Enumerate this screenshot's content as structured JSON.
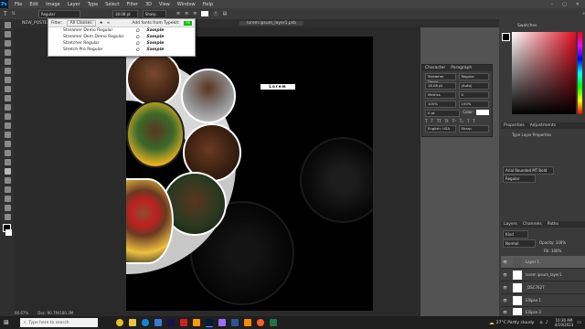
{
  "app": {
    "name": "Ps"
  },
  "menu": [
    "File",
    "Edit",
    "Image",
    "Layer",
    "Type",
    "Select",
    "Filter",
    "3D",
    "View",
    "Window",
    "Help"
  ],
  "options": {
    "font_size": "18.08 pt",
    "style": "Regular",
    "antialias": "Sharp"
  },
  "tabs": [
    "NEW_POSTER.psd",
    "lorem ipsum_layer1.psb"
  ],
  "font_menu": {
    "filter": "Filter:",
    "filter_value": "All Classes",
    "add_fonts": "Add fonts from Typekit:",
    "items": [
      {
        "name": "Streamer Demo Regular",
        "sample": "Sample"
      },
      {
        "name": "Streamer Dem Demo Regular",
        "sample": "Sample"
      },
      {
        "name": "Stretcher Regular",
        "sample": "Sample"
      },
      {
        "name": "Stretch Pro Regular",
        "sample": "Sample"
      }
    ]
  },
  "canvas_text": "Lorem Ipsum",
  "character_panel": {
    "tabs": [
      "Character",
      "Paragraph"
    ],
    "font": "Streamer Demo",
    "style": "Regular",
    "size": "18.08 pt",
    "leading": "(Auto)",
    "tracking": "0",
    "kerning": "Metrics",
    "scale_v": "100%",
    "scale_h": "100%",
    "baseline": "0 pt",
    "color_label": "Color:",
    "language": "English: USA",
    "aa": "Sharp"
  },
  "swatches": {
    "title": "Swatches"
  },
  "properties": {
    "tabs": [
      "Properties",
      "Adjustments"
    ],
    "title": "Type Layer Properties",
    "font": "Arial Rounded MT Bold",
    "style": "Regular"
  },
  "layers": {
    "tabs": [
      "Layers",
      "Channels",
      "Paths"
    ],
    "kind": "Kind",
    "mode": "Normal",
    "opacity": "Opacity: 100%",
    "fill": "Fill: 100%",
    "items": [
      "Layer 1",
      "lorem ipsum_layer1",
      "_DSC7627",
      "Ellipse 1",
      "Ellipse 3"
    ]
  },
  "status": {
    "zoom": "66.67%",
    "doc": "Doc: 90.7M/180.3M"
  },
  "taskbar": {
    "search": "Type here to search",
    "weather": "27°C Partly cloudy",
    "time": "10:30 AM",
    "date": "4/19/2023"
  },
  "colors": {
    "accent": "#31a8ff",
    "fg": "#000000"
  }
}
